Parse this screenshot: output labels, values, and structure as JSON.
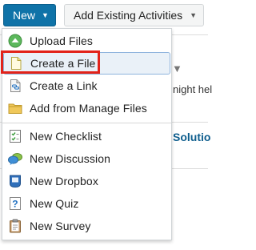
{
  "toolbar": {
    "new_label": "New",
    "add_existing_label": "Add Existing Activities"
  },
  "background": {
    "partial_text_1": "night hel",
    "partial_text_2": "Solutio"
  },
  "menu": {
    "items": [
      {
        "label": "Upload Files",
        "icon": "upload-icon"
      },
      {
        "label": "Create a File",
        "icon": "file-icon"
      },
      {
        "label": "Create a Link",
        "icon": "link-icon"
      },
      {
        "label": "Add from Manage Files",
        "icon": "folder-icon"
      },
      {
        "label": "New Checklist",
        "icon": "checklist-icon"
      },
      {
        "label": "New Discussion",
        "icon": "discussion-icon"
      },
      {
        "label": "New Dropbox",
        "icon": "dropbox-icon"
      },
      {
        "label": "New Quiz",
        "icon": "quiz-icon"
      },
      {
        "label": "New Survey",
        "icon": "survey-icon"
      }
    ]
  },
  "colors": {
    "primary_button": "#0f73a8",
    "highlight_border": "#e2231a",
    "selected_bg": "#eaf1f8",
    "link_text": "#0d5d8d"
  }
}
